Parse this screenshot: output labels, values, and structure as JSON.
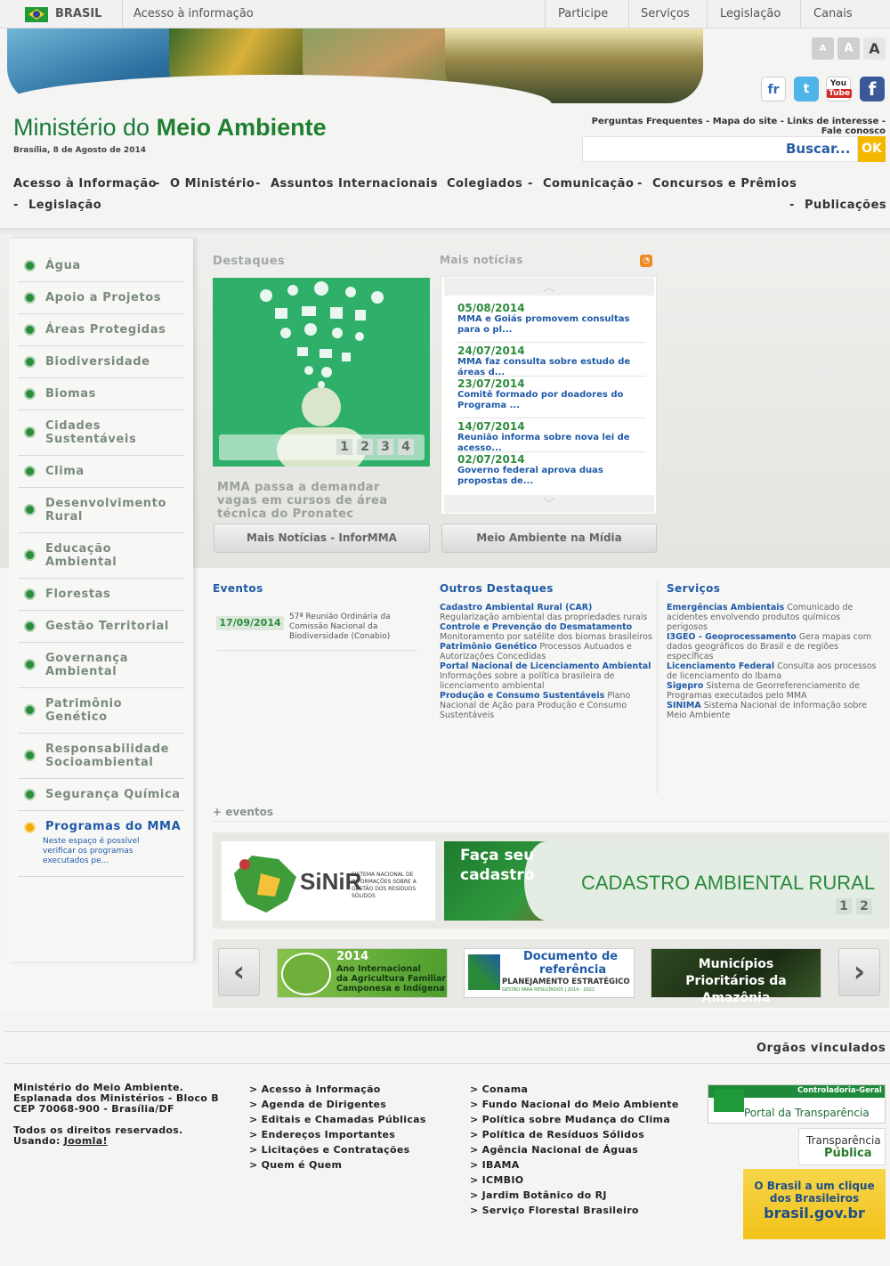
{
  "govbar": {
    "country": "BRASIL",
    "info": "Acesso à informação",
    "links": [
      "Participe",
      "Serviços",
      "Legislação",
      "Canais"
    ]
  },
  "fonts": {
    "smaller": "A",
    "normal": "A",
    "bigger": "A"
  },
  "social": {
    "fr": "fr",
    "tw": "t",
    "yt_top": "You",
    "yt_bot": "Tube",
    "fb": "f"
  },
  "site": {
    "title_a": "Ministério do ",
    "title_b": "Meio Ambiente",
    "date": "Brasília, 8 de Agosto de 2014"
  },
  "toplinks": "Perguntas Frequentes - Mapa do site - Links de interesse - Fale conosco",
  "search": {
    "label": "Buscar...",
    "ok": "OK"
  },
  "mainnav": {
    "items": [
      "Acesso à Informação",
      "O Ministério",
      "Assuntos Internacionais",
      "Colegiados",
      "Comunicação",
      "Concursos e Prêmios",
      "Legislação",
      "Publicações"
    ],
    "sep": "-"
  },
  "sidebar": [
    "Água",
    "Apoio a Projetos",
    "Áreas Protegidas",
    "Biodiversidade",
    "Biomas",
    "Cidades Sustentáveis",
    "Clima",
    "Desenvolvimento Rural",
    "Educação Ambiental",
    "Florestas",
    "Gestão Territorial",
    "Governança Ambiental",
    "Patrimônio Genético",
    "Responsabilidade Socioambiental",
    "Segurança Química"
  ],
  "programas": {
    "title": "Programas do MMA",
    "desc": "Neste espaço é possível verificar os programas executados pe..."
  },
  "destaques": {
    "title": "Destaques",
    "pages": [
      "1",
      "2",
      "3",
      "4"
    ],
    "caption": "MMA passa a demandar vagas em cursos de área técnica do Pronatec",
    "button": "Mais Notícias - InforMMA"
  },
  "news": {
    "title": "Mais notícias",
    "button": "Meio Ambiente na Mídia",
    "items": [
      {
        "date": "05/08/2014",
        "text": "MMA e Goiás promovem consultas para o pl..."
      },
      {
        "date": "24/07/2014",
        "text": "MMA faz consulta sobre estudo de áreas d..."
      },
      {
        "date": "23/07/2014",
        "text": "Comitê formado por doadores do Programa ..."
      },
      {
        "date": "14/07/2014",
        "text": "Reunião informa sobre nova lei de acesso..."
      },
      {
        "date": "02/07/2014",
        "text": "Governo federal aprova duas propostas de..."
      }
    ]
  },
  "eventos": {
    "title": "Eventos",
    "date": "17/09/2014",
    "text": "57ª Reunião Ordinária da Comissão Nacional da Biodiversidade (Conabio)",
    "more": "+ eventos"
  },
  "outros": {
    "title": "Outros Destaques",
    "items": [
      {
        "l": "Cadastro Ambiental Rural (CAR)",
        "d": " Regularização ambiental das propriedades rurais"
      },
      {
        "l": "Controle e Prevenção do Desmatamento",
        "d": " Monitoramento por satélite dos biomas brasileiros"
      },
      {
        "l": "Patrimônio Genético",
        "d": " Processos Autuados e Autorizações Concedidas"
      },
      {
        "l": "Portal Nacional de Licenciamento Ambiental",
        "d": " Informações sobre a política brasileira de licenciamento ambiental"
      },
      {
        "l": "Produção e Consumo Sustentáveis",
        "d": " Plano Nacional de Ação para Produção e Consumo Sustentáveis"
      }
    ]
  },
  "servicos": {
    "title": "Serviços",
    "items": [
      {
        "l": "Emergências Ambientais",
        "d": " Comunicado de acidentes envolvendo produtos químicos perigosos"
      },
      {
        "l": "I3GEO - Geoprocessamento",
        "d": " Gera mapas com dados geográficos do Brasil e de regiões específicas"
      },
      {
        "l": "Licenciamento Federal",
        "d": " Consulta aos processos de licenciamento do Ibama"
      },
      {
        "l": "Sigepro",
        "d": " Sistema de Georreferenciamento de Programas executados pelo MMA"
      },
      {
        "l": "SINIMA",
        "d": " Sistema Nacional de Informação sobre Meio Ambiente"
      }
    ]
  },
  "banners": {
    "sinir": "SiNiR",
    "sinir_desc": "SISTEMA NACIONAL DE INFORMAÇÕES SOBRE A GESTÃO DOS RESÍDUOS SÓLIDOS",
    "car_a": "Faça seu",
    "car_b": "cadastro",
    "car_c": "CADASTRO AMBIENTAL RURAL",
    "pages": [
      "1",
      "2"
    ]
  },
  "carousel": {
    "prev": "‹",
    "next": "›",
    "b1_year": "2014",
    "b1_l1": "Ano Internacional",
    "b1_l2": "da Agricultura Familiar",
    "b1_l3": "Camponesa e Indígena",
    "b2_l1": "Documento de",
    "b2_l2": "referência",
    "b2_l3": "PLANEJAMENTO ESTRATÉGICO",
    "b2_l4": "GESTÃO PARA RESULTADOS | 2014 - 2022",
    "b3_l1": "Municípios",
    "b3_l2": "Prioritários da Amazônia"
  },
  "footer": {
    "orgaos": "Orgãos vinculados",
    "addr": [
      "Ministério do Meio Ambiente.",
      "Esplanada dos Ministérios - Bloco B",
      "CEP 70068-900 - Brasília/DF"
    ],
    "rights": "Todos os direitos reservados.",
    "using": "Usando: ",
    "joomla": "Joomla!",
    "col2": [
      "> Acesso à Informação",
      "> Agenda de Dirigentes",
      "> Editais e Chamadas Públicas",
      "> Endereços Importantes",
      "> Licitações e Contratações",
      "> Quem é Quem"
    ],
    "col3": [
      "> Conama",
      "> Fundo Nacional do Meio Ambiente",
      "> Política sobre Mudança do Clima",
      "> Política de Resíduos Sólidos",
      "> Agência Nacional de Águas",
      "> IBAMA",
      "> ICMBIO",
      "> Jardim Botânico do RJ",
      "> Serviço Florestal Brasileiro"
    ],
    "cgu_a": "Controladoria-Geral",
    "cgu_b": "Portal da Transparência",
    "tp_a": "Transparência",
    "tp_b": "Pública",
    "br_a": "O Brasil a um clique",
    "br_b": "dos Brasileiros",
    "br_c": "brasil.gov.br"
  }
}
